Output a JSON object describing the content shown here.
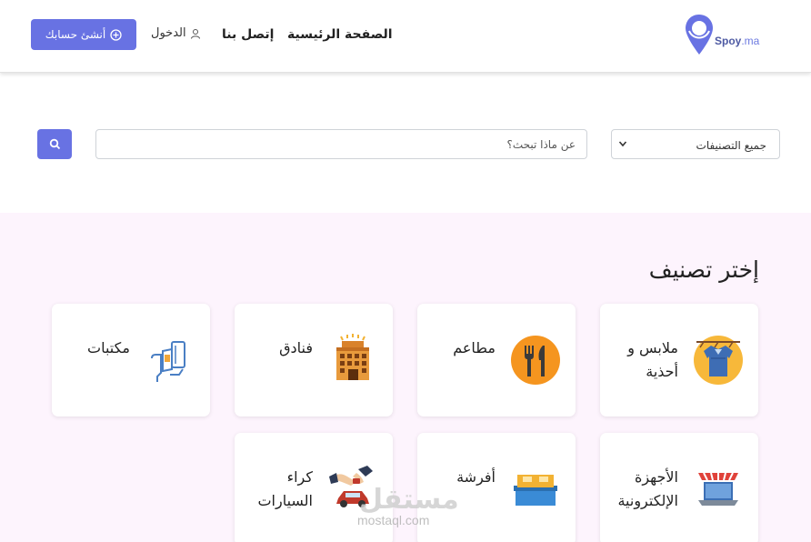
{
  "header": {
    "logo_text": "Spoy",
    "logo_tld": ".ma",
    "nav": {
      "home": "الصفحة الرئيسية",
      "contact": "إتصل بنا"
    },
    "login_label": "الدخول",
    "signup_label": "أنشئ حسابك"
  },
  "search": {
    "category_value": "جميع التصنيفات",
    "placeholder": "عن ماذا تبحث؟"
  },
  "categories": {
    "title": "إختر تصنيف",
    "items": [
      {
        "line1": "ملابس و",
        "line2": "أحذية",
        "icon": "clothes-icon"
      },
      {
        "line1": "مطاعم",
        "line2": "",
        "icon": "restaurant-icon"
      },
      {
        "line1": "فنادق",
        "line2": "",
        "icon": "hotel-icon"
      },
      {
        "line1": "مكتبات",
        "line2": "",
        "icon": "library-icon"
      },
      {
        "line1": "الأجهزة",
        "line2": "الإلكترونية",
        "icon": "electronics-icon"
      },
      {
        "line1": "أفرشة",
        "line2": "",
        "icon": "furniture-icon"
      },
      {
        "line1": "كراء",
        "line2": "السيارات",
        "icon": "car-rental-icon"
      }
    ]
  },
  "watermark": {
    "main": "مستقل",
    "sub": "mostaql.com"
  },
  "colors": {
    "accent": "#6872e3",
    "section_bg": "#fdf4fd"
  }
}
